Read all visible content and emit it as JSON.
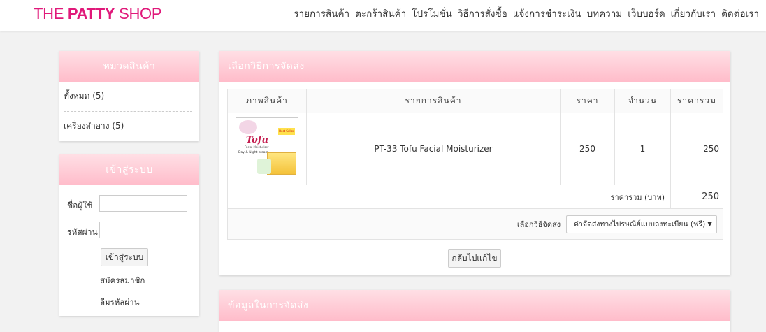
{
  "brand": {
    "prefix": "THE ",
    "bold": "PATTY",
    "suffix": " SHOP"
  },
  "nav": [
    "รายการสินค้า",
    "ตะกร้าสินค้า",
    "โปรโมชั่น",
    "วิธีการสั่งซื้อ",
    "แจ้งการชำระเงิน",
    "บทความ",
    "เว็บบอร์ด",
    "เกี่ยวกับเรา",
    "ติดต่อเรา"
  ],
  "categories": {
    "title": "หมวดสินค้า",
    "items": [
      {
        "label": "ทั้งหมด (5)"
      },
      {
        "label": "เครื่องสำอาง (5)"
      }
    ]
  },
  "login": {
    "title": "เข้าสู่ระบบ",
    "username_label": "ชื่อผู้ใช้",
    "password_label": "รหัสผ่าน",
    "submit_label": "เข้าสู่ระบบ",
    "register_link": "สมัครสมาชิก",
    "forgot_link": "ลืมรหัสผ่าน"
  },
  "shipping": {
    "title": "เลือกวิธีการจัดส่ง",
    "columns": [
      "ภาพสินค้า",
      "รายการสินค้า",
      "ราคา",
      "จำนวน",
      "ราคารวม"
    ],
    "rows": [
      {
        "name": "PT-33 Tofu Facial Moisturizer",
        "price": "250",
        "qty": "1",
        "total": "250"
      }
    ],
    "total_label": "ราคารวม (บาท)",
    "total_value": "250",
    "method_label": "เลือกวิธีจัดส่ง",
    "method_selected": "ค่าจัดส่งทางไปรษณีย์แบบลงทะเบียน (ฟรี)",
    "back_label": "กลับไปแก้ไข"
  },
  "product_image": {
    "brand": "Tofu",
    "sub": "Facial Moisturizer",
    "badge": "Best Seller",
    "line": "Day & Night cream"
  },
  "delivery": {
    "title": "ข้อมูลในการจัดส่ง"
  },
  "colors": {
    "brand": "#e0197a",
    "panel_header": "#ffbcca"
  }
}
